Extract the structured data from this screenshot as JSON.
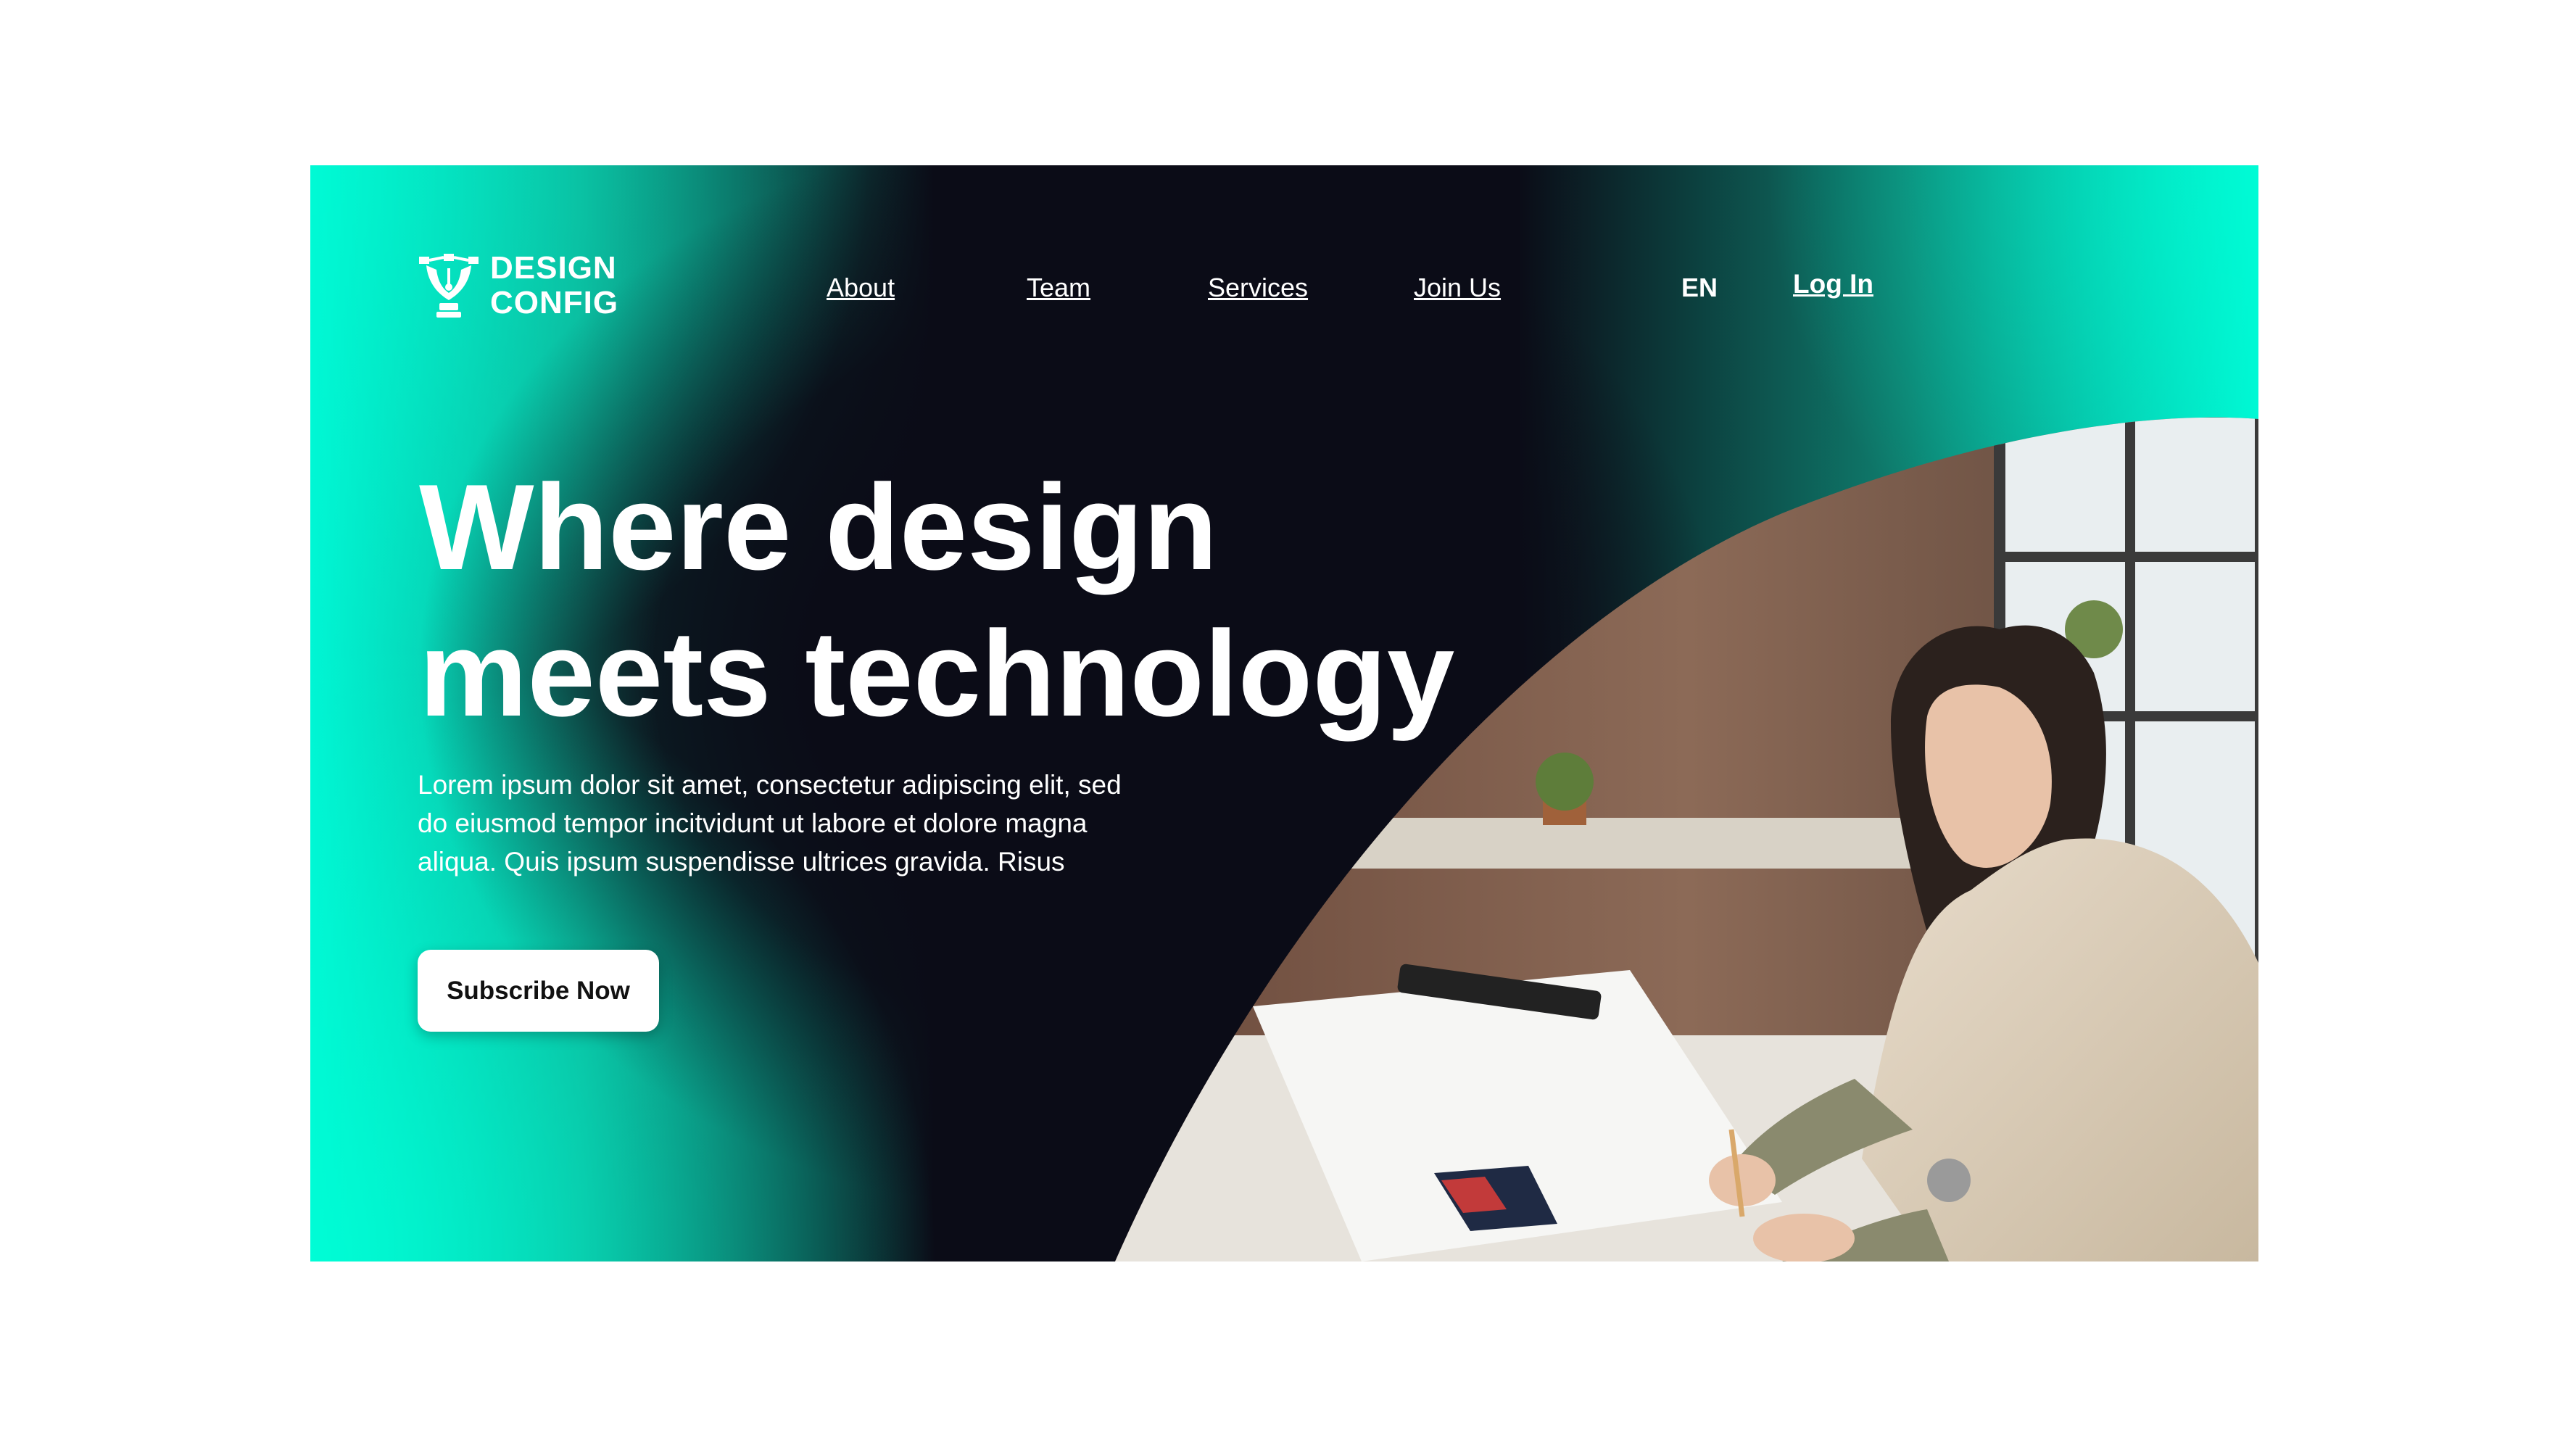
{
  "brand": {
    "line1": "DESIGN",
    "line2": "CONFIG",
    "logo_icon": "pen-nib-icon"
  },
  "nav": {
    "items": [
      "About",
      "Team",
      "Services",
      "Join Us"
    ],
    "language": "EN",
    "login": "Log In"
  },
  "hero": {
    "headline_line1": "Where design",
    "headline_line2": "meets technology",
    "description_lines": [
      "Lorem ipsum dolor sit amet, consectetur adipiscing elit, sed",
      "do eiusmod tempor incitvidunt ut labore et dolore magna",
      "aliqua. Quis ipsum suspendisse ultrices gravida. Risus"
    ],
    "cta_label": "Subscribe Now"
  },
  "colors": {
    "accent": "#00f5d4",
    "dark": "#0b0c17",
    "text": "#ffffff",
    "button_bg": "#ffffff"
  }
}
